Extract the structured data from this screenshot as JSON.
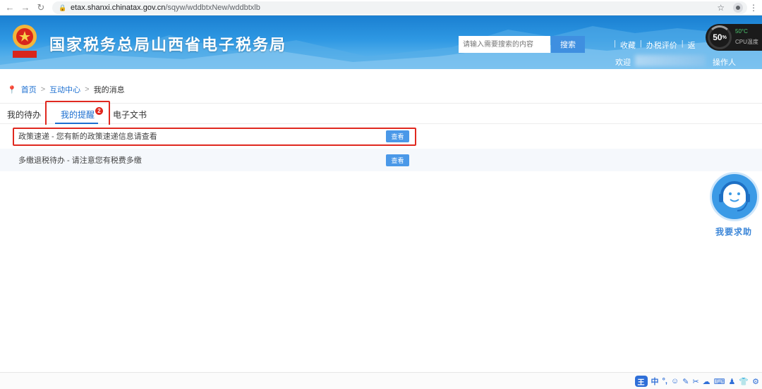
{
  "browser": {
    "url_host": "etax.shanxi.chinatax.gov.cn",
    "url_path": "/sqyw/wddbtxNew/wddbtxlb"
  },
  "header": {
    "title": "国家税务总局山西省电子税务局",
    "search_placeholder": "请输入需要搜索的内容",
    "search_button": "搜索",
    "links": [
      "收藏",
      "办税评价",
      "返"
    ],
    "welcome": "欢迎",
    "operator": "操作人"
  },
  "cpu_widget": {
    "percent": "50",
    "percent_unit": "%",
    "temp": "50°C",
    "label": "CPU温度"
  },
  "breadcrumb": {
    "home": "首页",
    "section": "互动中心",
    "current": "我的消息",
    "separator": ">"
  },
  "tabs": [
    {
      "label": "我的待办"
    },
    {
      "label": "我的提醒",
      "active": true,
      "badge": "2"
    },
    {
      "label": "电子文书"
    }
  ],
  "messages": [
    {
      "text": "政策速递 - 您有新的政策速递信息请查看",
      "action": "查看"
    },
    {
      "text": "多缴退税待办 - 请注意您有税费多缴",
      "action": "查看"
    }
  ],
  "help": {
    "label": "我要求助"
  },
  "ime_toolbar": {
    "logo": "王",
    "mode": "中",
    "items": [
      "°,",
      "☺",
      "✎",
      "✂",
      "☁",
      "⌨",
      "♟",
      "👕",
      "⚙"
    ]
  },
  "colors": {
    "accent": "#1c6fd1",
    "highlight": "#e0281f",
    "button": "#4a98e8"
  }
}
